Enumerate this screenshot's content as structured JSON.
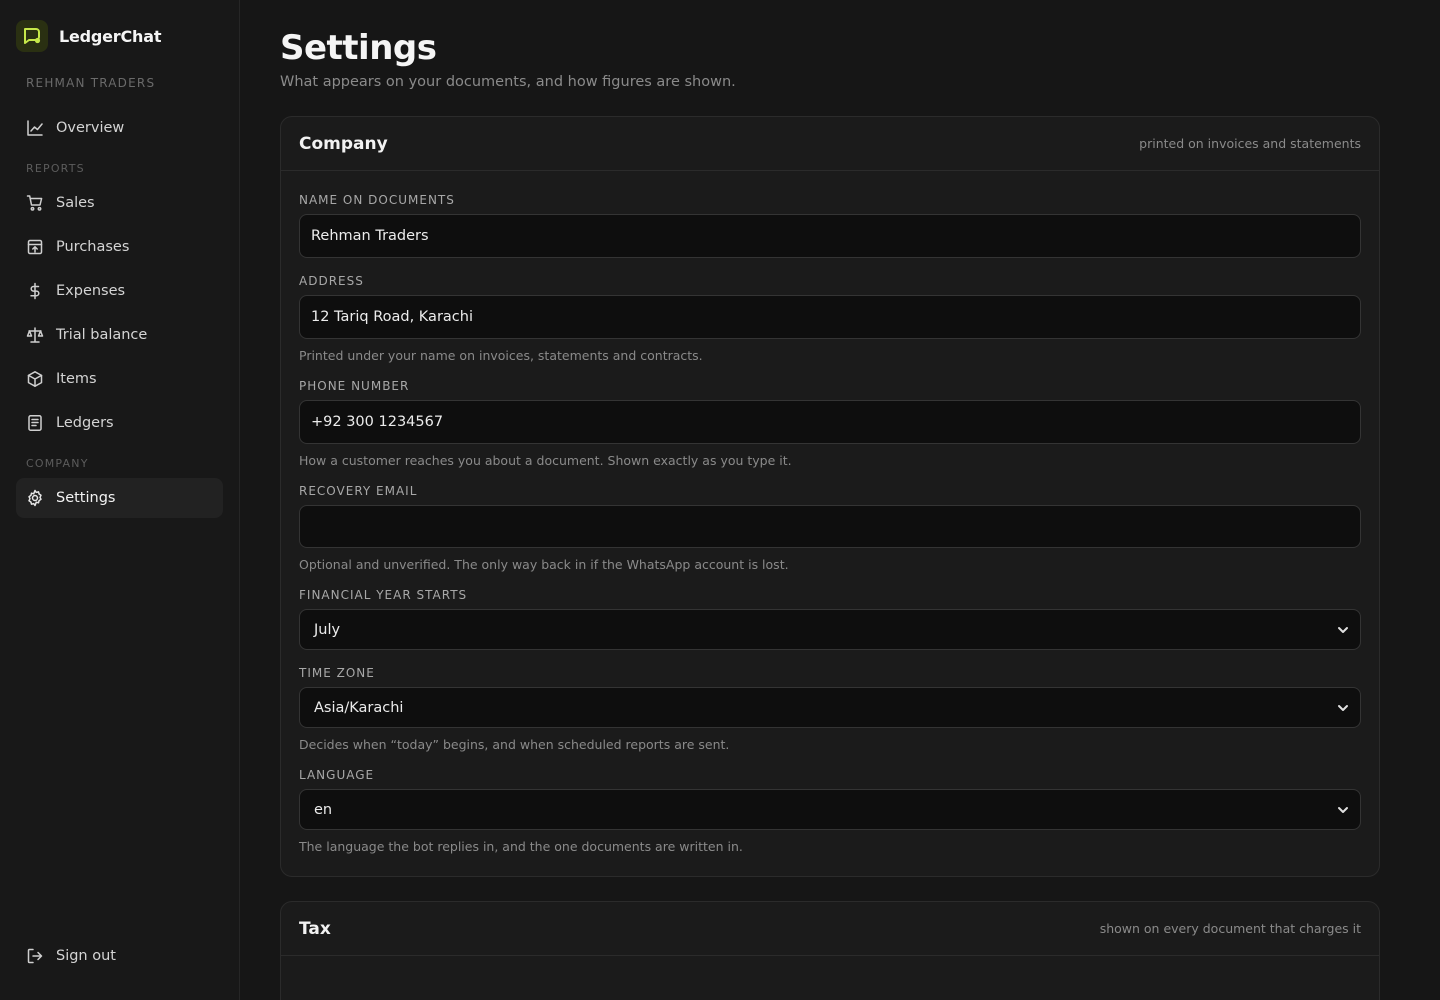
{
  "brand": {
    "name": "LedgerChat"
  },
  "sidebar": {
    "company_label": "REHMAN TRADERS",
    "reports_label": "REPORTS",
    "company_section_label": "COMPANY",
    "items": {
      "overview": "Overview",
      "sales": "Sales",
      "purchases": "Purchases",
      "expenses": "Expenses",
      "trial_balance": "Trial balance",
      "items": "Items",
      "ledgers": "Ledgers",
      "settings": "Settings"
    },
    "signout": "Sign out"
  },
  "page": {
    "title": "Settings",
    "subtitle": "What appears on your documents, and how figures are shown."
  },
  "company_card": {
    "title": "Company",
    "note": "printed on invoices and statements",
    "name_label": "NAME ON DOCUMENTS",
    "name_value": "Rehman Traders",
    "address_label": "ADDRESS",
    "address_value": "12 Tariq Road, Karachi",
    "address_hint": "Printed under your name on invoices, statements and contracts.",
    "phone_label": "PHONE NUMBER",
    "phone_value": "+92 300 1234567",
    "phone_hint": "How a customer reaches you about a document. Shown exactly as you type it.",
    "email_label": "RECOVERY EMAIL",
    "email_value": "",
    "email_hint": "Optional and unverified. The only way back in if the WhatsApp account is lost.",
    "fy_label": "FINANCIAL YEAR STARTS",
    "fy_value": "July",
    "tz_label": "TIME ZONE",
    "tz_value": "Asia/Karachi",
    "tz_hint": "Decides when “today” begins, and when scheduled reports are sent.",
    "lang_label": "LANGUAGE",
    "lang_value": "en",
    "lang_hint": "The language the bot replies in, and the one documents are written in."
  },
  "tax_card": {
    "title": "Tax",
    "note": "shown on every document that charges it"
  },
  "colors": {
    "accent": "#c6e84a",
    "background": "#161616"
  }
}
